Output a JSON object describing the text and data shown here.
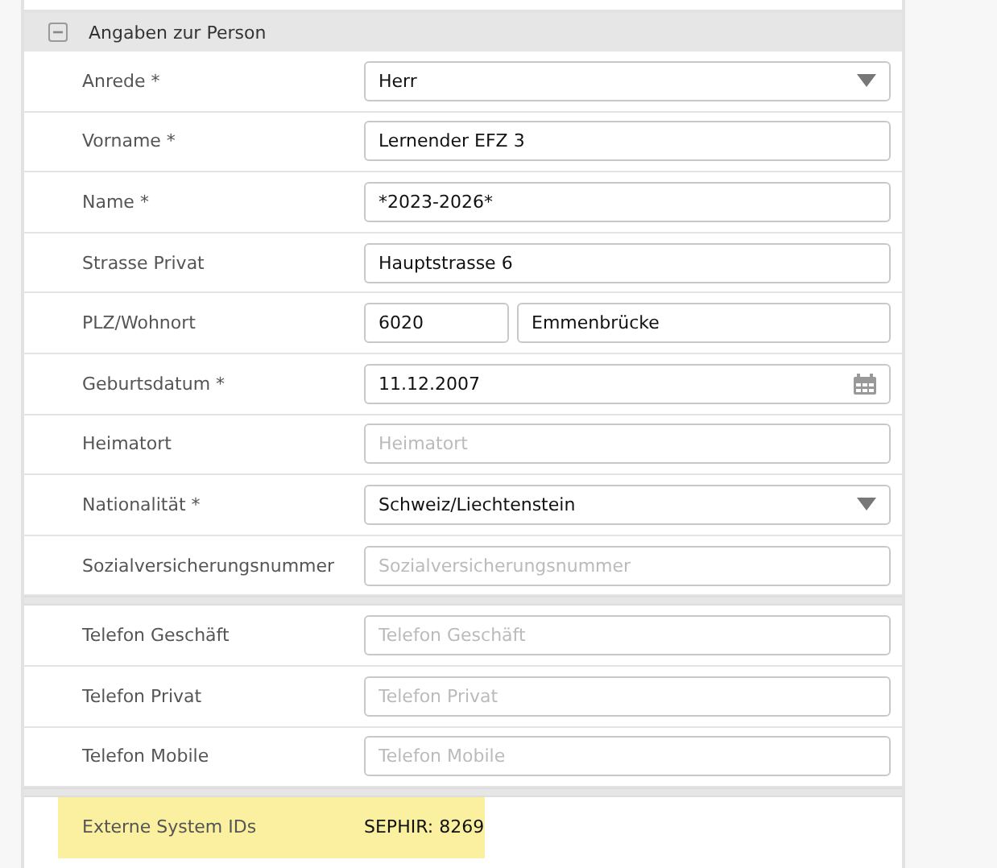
{
  "section": {
    "title": "Angaben zur Person",
    "expanded": true
  },
  "groups": [
    {
      "rows": [
        {
          "label": "Anrede *",
          "kind": "select",
          "value": "Herr"
        },
        {
          "label": "Vorname *",
          "kind": "text",
          "value": "Lernender EFZ 3"
        },
        {
          "label": "Name *",
          "kind": "text",
          "value": "*2023-2026*"
        },
        {
          "label": "Strasse Privat",
          "kind": "text",
          "value": "Hauptstrasse 6"
        },
        {
          "label": "PLZ/Wohnort",
          "kind": "pair",
          "value": "6020",
          "value2": "Emmenbrücke"
        },
        {
          "label": "Geburtsdatum *",
          "kind": "date",
          "value": "11.12.2007"
        },
        {
          "label": "Heimatort",
          "kind": "text",
          "placeholder": "Heimatort"
        },
        {
          "label": "Nationalität *",
          "kind": "select",
          "value": "Schweiz/Liechtenstein"
        },
        {
          "label": "Sozialversicherungsnummer",
          "kind": "text",
          "placeholder": "Sozialversicherungsnummer"
        }
      ]
    },
    {
      "rows": [
        {
          "label": "Telefon Geschäft",
          "kind": "text",
          "placeholder": "Telefon Geschäft"
        },
        {
          "label": "Telefon Privat",
          "kind": "text",
          "placeholder": "Telefon Privat"
        },
        {
          "label": "Telefon Mobile",
          "kind": "text",
          "placeholder": "Telefon Mobile"
        }
      ]
    },
    {
      "rows": [
        {
          "label": "Externe System IDs",
          "kind": "static",
          "value": "SEPHIR: 8269",
          "highlighted": true
        }
      ]
    }
  ]
}
